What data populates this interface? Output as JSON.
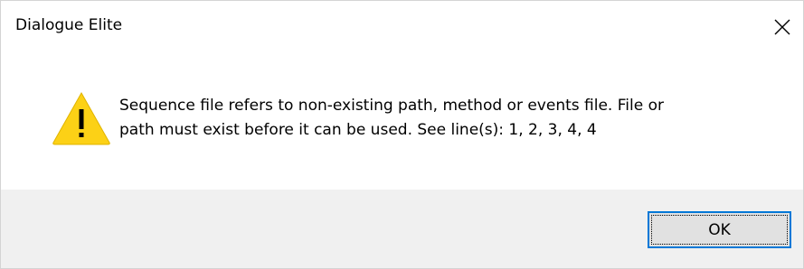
{
  "window": {
    "title": "Dialogue Elite",
    "close_icon": "close-icon"
  },
  "dialog": {
    "icon": "warning-icon",
    "message_line1": "Sequence file refers to non-existing path, method or events file. File or",
    "message_line2": "path must exist before it can be used. See line(s): 1, 2, 3, 4, 4"
  },
  "buttons": {
    "ok_label": "OK"
  },
  "colors": {
    "warning_fill": "#FCD116",
    "focus_border": "#0078D7",
    "footer_bg": "#F0F0F0"
  }
}
